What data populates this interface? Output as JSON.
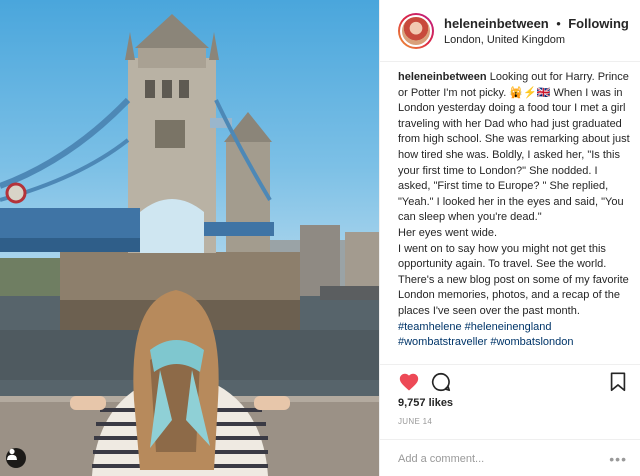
{
  "post": {
    "username": "heleneinbetween",
    "separator": "•",
    "follow_status": "Following",
    "location": "London, United Kingdom"
  },
  "caption": {
    "username": "heleneinbetween",
    "lines": [
      "Looking out for Harry. Prince or Potter I'm not picky. 🙀⚡🇬🇧 When I was in London yesterday doing a food tour I met a girl traveling with her Dad who had just graduated from high school. She was remarking about just how tired she was. Boldly, I asked her, \"Is this your first time to London?\" She nodded. I asked, \"First time to Europe? \" She replied, \"Yeah.\" I looked her in the eyes and said, \"You can sleep when you're dead.\"",
      "Her eyes went wide.",
      "I went on to say how you might not get this opportunity again. To travel. See the world. There's a new blog post on some of my favorite London memories, photos, and a recap of the places I've seen over the past month."
    ],
    "hashtags": [
      "#teamhelene",
      "#heleneinengland",
      "#wombatstraveller",
      "#wombatslondon"
    ]
  },
  "stats": {
    "likes": "9,757 likes",
    "date": "JUNE 14"
  },
  "comment_box": {
    "placeholder": "Add a comment...",
    "more": "•••"
  },
  "icons": {
    "like": "heart-icon",
    "comment": "speech-bubble-icon",
    "save": "bookmark-icon",
    "user_tag": "person-icon"
  },
  "colors": {
    "like_red": "#ed4956",
    "hashtag": "#003569",
    "muted": "#999999",
    "divider": "#efefef"
  }
}
